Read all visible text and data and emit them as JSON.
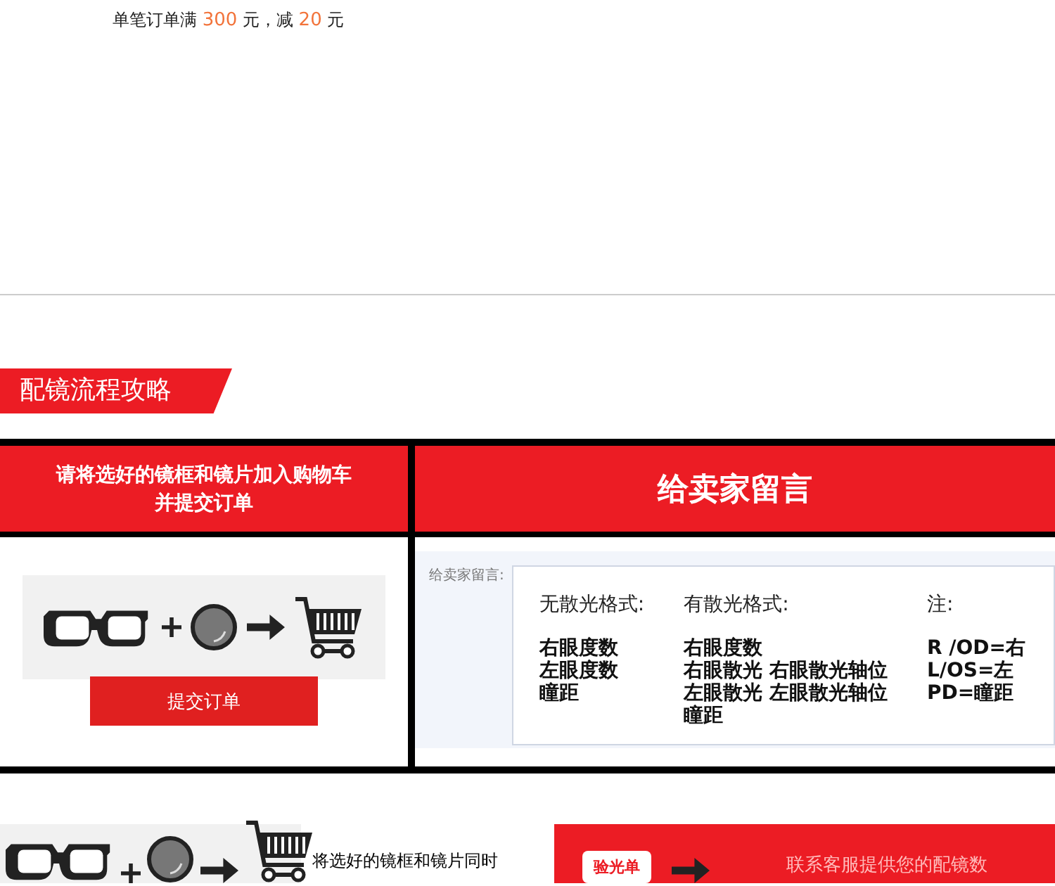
{
  "promo": "单笔订单满 **300** 元，减 **20** 元",
  "section_title": "配镜流程攻略",
  "steps": [
    {
      "heading_lines": [
        "请将选好的镜框和镜片加入购物车",
        "并提交订单"
      ],
      "button": "提交订单"
    },
    {
      "heading": "给卖家留言",
      "field_label": "给卖家留言:",
      "formats": [
        {
          "title": "无散光格式:",
          "lines": [
            "右眼度数",
            "左眼度数",
            "瞳距"
          ]
        },
        {
          "title": "有散光格式:",
          "lines": [
            "右眼度数",
            "右眼散光 右眼散光轴位",
            "左眼散光 左眼散光轴位",
            "瞳距"
          ]
        },
        {
          "title": "注:",
          "lines": [
            "R /OD=右",
            "L/OS=左",
            "PD=瞳距"
          ]
        }
      ]
    }
  ],
  "next": {
    "text": "将选好的镜框和镜片同时",
    "card_label": "验光单",
    "card_text": "联系客服提供您的配镜数"
  }
}
